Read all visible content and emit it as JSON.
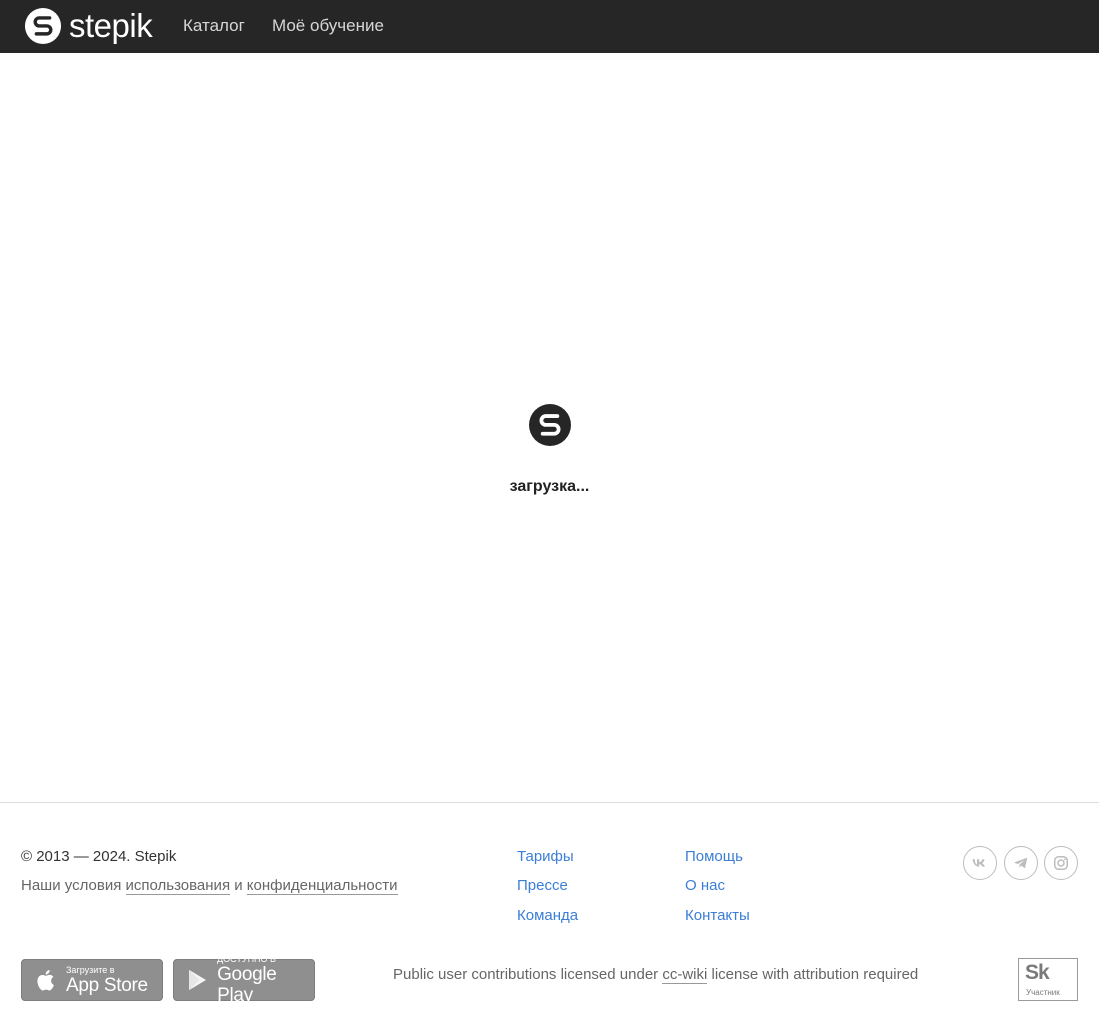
{
  "header": {
    "logo_text": "stepik",
    "nav": [
      "Каталог",
      "Моё обучение"
    ]
  },
  "loader": {
    "text": "загрузка..."
  },
  "footer": {
    "copyright": "© 2013 — 2024. Stepik",
    "terms_prefix": "Наши условия",
    "terms_usage": "использования",
    "terms_and": "и",
    "terms_privacy": "конфиденциальности",
    "links_col1": [
      "Тарифы",
      "Прессе",
      "Команда"
    ],
    "links_col2": [
      "Помощь",
      "О нас",
      "Контакты"
    ],
    "social_icons": [
      "vk-icon",
      "telegram-icon",
      "instagram-icon"
    ],
    "app_store": {
      "small": "Загрузите в",
      "big": "App Store"
    },
    "google_play": {
      "small": "ДОСТУПНО В",
      "big": "Google Play"
    },
    "license_prefix": "Public user contributions licensed under",
    "license_link": "cc-wiki",
    "license_suffix": "license with attribution required",
    "skolkovo": {
      "logo": "Sk",
      "label": "Участник"
    }
  },
  "colors": {
    "header_bg": "#262626",
    "link_blue": "#3b7ed6",
    "muted_text": "#666666"
  }
}
